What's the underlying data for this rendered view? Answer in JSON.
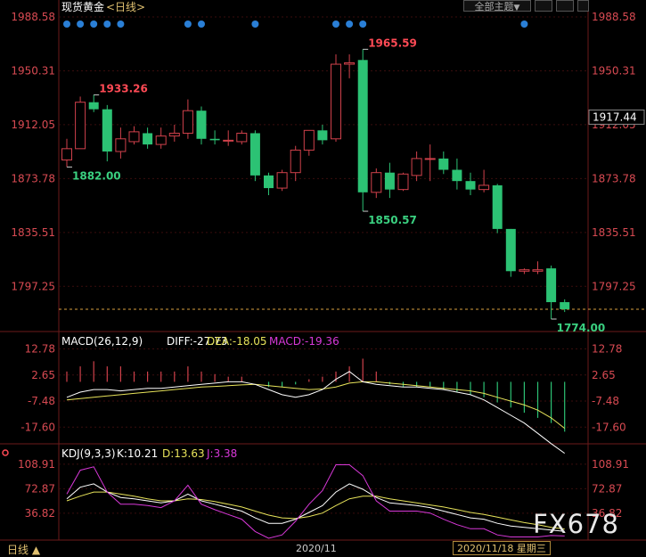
{
  "header": {
    "title": "现货黄金",
    "period_tag": "<日线>",
    "theme_button": "全部主题",
    "arrow_down": "▼"
  },
  "colors": {
    "up": "#d0414b",
    "down": "#2cc274",
    "axis_text": "#d84a52",
    "grid": "#3a0d0d",
    "dif": "#ffffff",
    "dea": "#e7e35a",
    "k": "#ffffff",
    "d": "#e7e35a",
    "j": "#d838d8",
    "dot": "#2a7fd6",
    "last_price_line": "#d8a040"
  },
  "chart_data": [
    {
      "type": "candlestick",
      "title": "现货黄金",
      "period": "日线",
      "ylim": [
        1774.0,
        1988.58
      ],
      "yticks": [
        "1988.58",
        "1950.31",
        "1912.05",
        "1873.78",
        "1835.51",
        "1797.25"
      ],
      "current_price": "1917.44",
      "annotations": [
        {
          "label": "1933.26",
          "type": "high",
          "index": 2
        },
        {
          "label": "1882.00",
          "type": "low",
          "index": 0
        },
        {
          "label": "1965.59",
          "type": "high",
          "index": 22
        },
        {
          "label": "1850.57",
          "type": "low",
          "index": 22
        },
        {
          "label": "1774.00",
          "type": "low",
          "index": 36
        }
      ],
      "event_dot_indices": [
        0,
        1,
        2,
        3,
        4,
        9,
        10,
        14,
        20,
        21,
        22,
        34
      ],
      "candles": [
        {
          "o": 1887,
          "h": 1902,
          "l": 1882,
          "c": 1895
        },
        {
          "o": 1895,
          "h": 1932,
          "l": 1895,
          "c": 1928
        },
        {
          "o": 1928,
          "h": 1933.26,
          "l": 1921,
          "c": 1923
        },
        {
          "o": 1923,
          "h": 1926,
          "l": 1886,
          "c": 1893
        },
        {
          "o": 1893,
          "h": 1910,
          "l": 1888,
          "c": 1902
        },
        {
          "o": 1900,
          "h": 1911,
          "l": 1898,
          "c": 1907
        },
        {
          "o": 1906,
          "h": 1910,
          "l": 1895,
          "c": 1898
        },
        {
          "o": 1898,
          "h": 1910,
          "l": 1895,
          "c": 1904
        },
        {
          "o": 1904,
          "h": 1912,
          "l": 1900,
          "c": 1906
        },
        {
          "o": 1906,
          "h": 1930,
          "l": 1902,
          "c": 1922
        },
        {
          "o": 1922,
          "h": 1925,
          "l": 1898,
          "c": 1902
        },
        {
          "o": 1902,
          "h": 1908,
          "l": 1898,
          "c": 1901
        },
        {
          "o": 1901,
          "h": 1908,
          "l": 1897,
          "c": 1901
        },
        {
          "o": 1900,
          "h": 1908,
          "l": 1898,
          "c": 1906
        },
        {
          "o": 1906,
          "h": 1908,
          "l": 1872,
          "c": 1876
        },
        {
          "o": 1876,
          "h": 1878,
          "l": 1862,
          "c": 1867
        },
        {
          "o": 1867,
          "h": 1880,
          "l": 1865,
          "c": 1878
        },
        {
          "o": 1878,
          "h": 1897,
          "l": 1872,
          "c": 1894
        },
        {
          "o": 1894,
          "h": 1908,
          "l": 1890,
          "c": 1908
        },
        {
          "o": 1908,
          "h": 1912,
          "l": 1898,
          "c": 1901
        },
        {
          "o": 1902,
          "h": 1962,
          "l": 1900,
          "c": 1955
        },
        {
          "o": 1955,
          "h": 1962,
          "l": 1945,
          "c": 1956
        },
        {
          "o": 1958,
          "h": 1965.59,
          "l": 1850.57,
          "c": 1864
        },
        {
          "o": 1864,
          "h": 1881,
          "l": 1860,
          "c": 1878
        },
        {
          "o": 1878,
          "h": 1885,
          "l": 1860,
          "c": 1866
        },
        {
          "o": 1866,
          "h": 1878,
          "l": 1865,
          "c": 1877
        },
        {
          "o": 1876,
          "h": 1893,
          "l": 1872,
          "c": 1888
        },
        {
          "o": 1888,
          "h": 1898,
          "l": 1872,
          "c": 1888
        },
        {
          "o": 1888,
          "h": 1893,
          "l": 1877,
          "c": 1880
        },
        {
          "o": 1880,
          "h": 1888,
          "l": 1866,
          "c": 1872
        },
        {
          "o": 1872,
          "h": 1878,
          "l": 1862,
          "c": 1866
        },
        {
          "o": 1866,
          "h": 1880,
          "l": 1864,
          "c": 1869
        },
        {
          "o": 1869,
          "h": 1870,
          "l": 1835,
          "c": 1838
        },
        {
          "o": 1838,
          "h": 1838,
          "l": 1804,
          "c": 1808
        },
        {
          "o": 1808,
          "h": 1810,
          "l": 1806,
          "c": 1809
        },
        {
          "o": 1808,
          "h": 1815,
          "l": 1806,
          "c": 1809
        },
        {
          "o": 1810,
          "h": 1812,
          "l": 1774.0,
          "c": 1786
        },
        {
          "o": 1786,
          "h": 1788,
          "l": 1779,
          "c": 1781
        }
      ]
    },
    {
      "type": "bar",
      "title": "MACD(26,12,9)",
      "labels": {
        "dif": "DIFF:-27.73",
        "dea": "DEA:-18.05",
        "macd": "MACD:-19.36"
      },
      "ylim": [
        -22,
        14
      ],
      "yticks": [
        "12.78",
        "2.65",
        "-7.48",
        "-17.60"
      ],
      "macd": [
        4,
        6,
        8,
        6,
        6,
        4,
        4,
        4,
        4,
        6,
        4,
        3,
        2,
        2,
        0,
        -2,
        -2,
        -1,
        1,
        2,
        4,
        6,
        9,
        4,
        -1,
        -2,
        -2,
        -2,
        -3,
        -4,
        -5,
        -6,
        -8,
        -10,
        -12,
        -14,
        -16,
        -19.36
      ],
      "dif": [
        -6,
        -4,
        -3,
        -3,
        -3.5,
        -3,
        -2.5,
        -2.5,
        -2,
        -1.5,
        -1,
        -0.5,
        0,
        0,
        -1,
        -3,
        -5,
        -6,
        -5,
        -3,
        1,
        4,
        0,
        -1,
        -1.5,
        -2,
        -2,
        -2.5,
        -3,
        -4,
        -5,
        -7,
        -10,
        -13,
        -16,
        -20,
        -24,
        -27.73
      ],
      "dea": [
        -7,
        -6.5,
        -6,
        -5.5,
        -5,
        -4.5,
        -4,
        -3.5,
        -3,
        -2.5,
        -2,
        -1.8,
        -1.5,
        -1.2,
        -1,
        -1.5,
        -2,
        -2.5,
        -3,
        -2.8,
        -2,
        -0.5,
        0,
        0,
        -0.5,
        -1,
        -1.5,
        -2,
        -2.5,
        -3,
        -3.5,
        -4.5,
        -6,
        -7.5,
        -9,
        -11,
        -14,
        -18.05
      ]
    },
    {
      "type": "line",
      "title": "KDJ(9,3,3)",
      "labels": {
        "k": "K:10.21",
        "d": "D:13.63",
        "j": "J:3.38"
      },
      "ylim": [
        0,
        110
      ],
      "yticks": [
        "108.91",
        "72.87",
        "36.82"
      ],
      "x_label": "2020/11",
      "current_date": "2020/11/18 星期三",
      "period_label": "日线 ▲",
      "k": [
        58,
        75,
        80,
        68,
        60,
        58,
        55,
        52,
        55,
        65,
        55,
        50,
        45,
        40,
        30,
        22,
        22,
        28,
        38,
        48,
        68,
        80,
        72,
        60,
        52,
        50,
        48,
        45,
        40,
        35,
        30,
        28,
        22,
        18,
        16,
        14,
        12,
        10.21
      ],
      "d": [
        55,
        62,
        68,
        68,
        65,
        62,
        58,
        55,
        55,
        58,
        57,
        54,
        50,
        46,
        40,
        34,
        30,
        29,
        32,
        37,
        48,
        58,
        62,
        62,
        58,
        55,
        52,
        49,
        46,
        42,
        38,
        35,
        31,
        27,
        23,
        20,
        16,
        13.63
      ],
      "j": [
        65,
        100,
        105,
        68,
        50,
        50,
        48,
        45,
        55,
        78,
        50,
        42,
        35,
        28,
        10,
        0,
        5,
        25,
        50,
        70,
        108,
        108,
        92,
        55,
        40,
        40,
        40,
        37,
        28,
        20,
        14,
        14,
        5,
        2,
        2,
        2,
        4,
        3.38
      ]
    }
  ],
  "watermark": "FX678"
}
